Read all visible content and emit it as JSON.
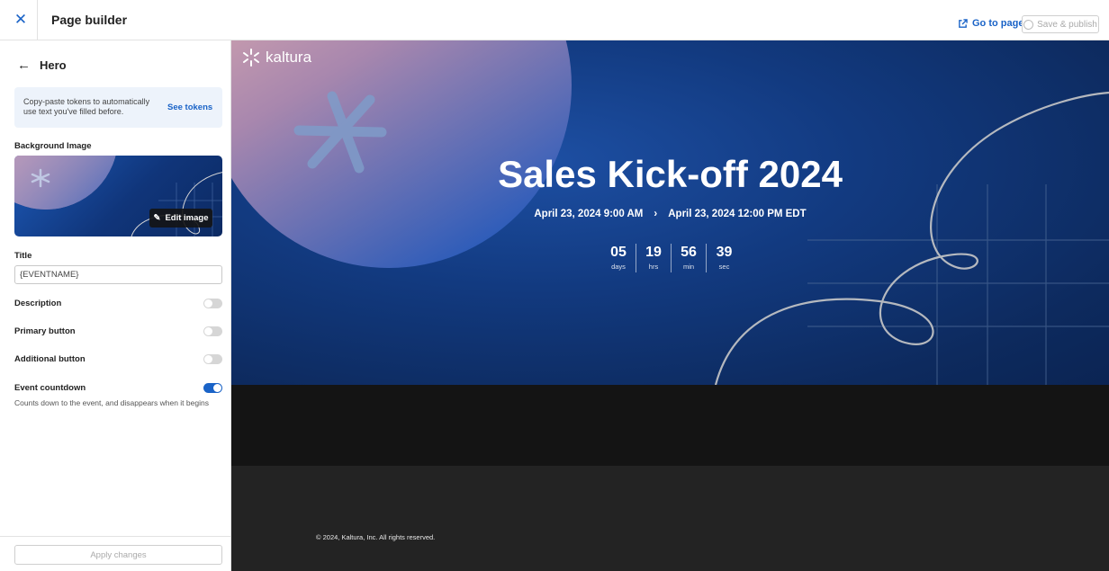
{
  "topbar": {
    "close_icon": "close-icon",
    "title": "Page builder",
    "go_to_page_label": "Go to page",
    "save_publish_label": "Save & publish"
  },
  "sidebar": {
    "section_title": "Hero",
    "tokens_hint": "Copy-paste tokens to automatically use text you've filled before.",
    "see_tokens_label": "See tokens",
    "background_image_label": "Background Image",
    "edit_image_label": "Edit image",
    "title_label": "Title",
    "title_value": "{EVENTNAME}",
    "toggles": [
      {
        "label": "Description",
        "on": false
      },
      {
        "label": "Primary button",
        "on": false
      },
      {
        "label": "Additional button",
        "on": false
      },
      {
        "label": "Event countdown",
        "on": true
      }
    ],
    "countdown_helper": "Counts down to the event, and disappears when it begins",
    "apply_label": "Apply changes"
  },
  "preview": {
    "logo_text": "kaltura",
    "event_title": "Sales Kick-off 2024",
    "start": "April 23, 2024 9:00 AM",
    "separator": "›",
    "end": "April 23, 2024 12:00 PM EDT",
    "countdown": [
      {
        "value": "05",
        "unit": "days"
      },
      {
        "value": "19",
        "unit": "hrs"
      },
      {
        "value": "56",
        "unit": "min"
      },
      {
        "value": "39",
        "unit": "sec"
      }
    ],
    "copyright": "© 2024, Kaltura, Inc. All rights reserved."
  },
  "colors": {
    "accent": "#1a63c7",
    "hero_blue": "#123a80",
    "footer_dark": "#232323"
  }
}
